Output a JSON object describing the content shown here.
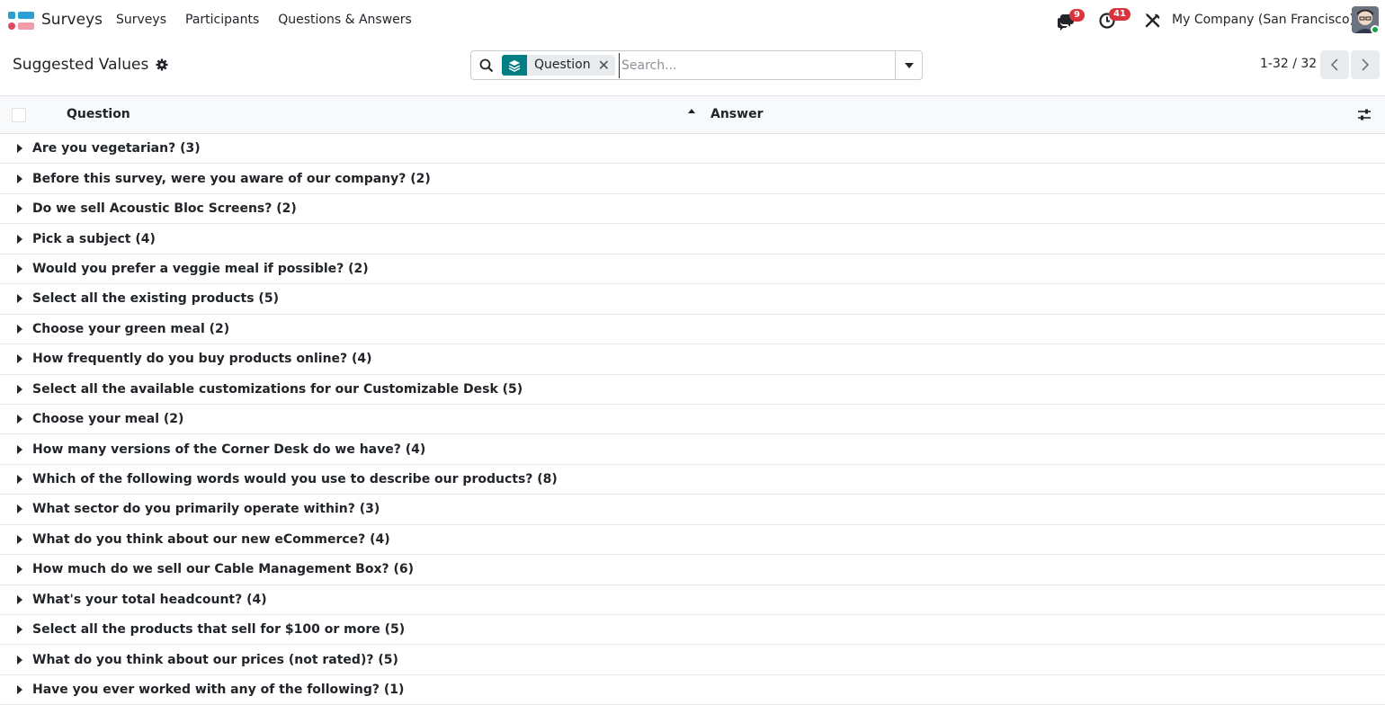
{
  "app": {
    "name": "Surveys"
  },
  "nav": {
    "items": [
      "Surveys",
      "Participants",
      "Questions & Answers"
    ]
  },
  "systray": {
    "messages_count": "9",
    "activities_count": "41",
    "company": "My Company (San Francisco)"
  },
  "page": {
    "title": "Suggested Values"
  },
  "search": {
    "facet_label": "Question",
    "placeholder": "Search..."
  },
  "pager": {
    "value": "1-32 / 32"
  },
  "table": {
    "columns": [
      "Question",
      "Answer"
    ],
    "groups": [
      "Are you vegetarian? (3)",
      "Before this survey, were you aware of our company? (2)",
      "Do we sell Acoustic Bloc Screens? (2)",
      "Pick a subject (4)",
      "Would you prefer a veggie meal if possible? (2)",
      "Select all the existing products (5)",
      "Choose your green meal (2)",
      "How frequently do you buy products online? (4)",
      "Select all the available customizations for our Customizable Desk (5)",
      "Choose your meal (2)",
      "How many versions of the Corner Desk do we have? (4)",
      "Which of the following words would you use to describe our products? (8)",
      "What sector do you primarily operate within? (3)",
      "What do you think about our new eCommerce? (4)",
      "How much do we sell our Cable Management Box? (6)",
      "What's your total headcount? (4)",
      "Select all the products that sell for $100 or more (5)",
      "What do you think about our prices (not rated)? (5)",
      "Have you ever worked with any of the following? (1)"
    ]
  },
  "colors": {
    "brand_teal": "#017e84",
    "badge_red": "#d9343b",
    "header_bg": "#f8f9fa"
  },
  "icons": {
    "app_logo": "surveys-logo-icon",
    "messages": "chat-bubbles-icon",
    "activities": "clock-icon",
    "debug": "tools-icon",
    "settings": "gear-icon",
    "search": "search-icon",
    "facet": "layers-icon",
    "remove": "close-icon",
    "toggle": "caret-down-icon",
    "prev": "chevron-left-icon",
    "next": "chevron-right-icon",
    "sort": "sort-up-icon",
    "optional_columns": "sliders-icon",
    "group_caret": "caret-right-icon"
  }
}
